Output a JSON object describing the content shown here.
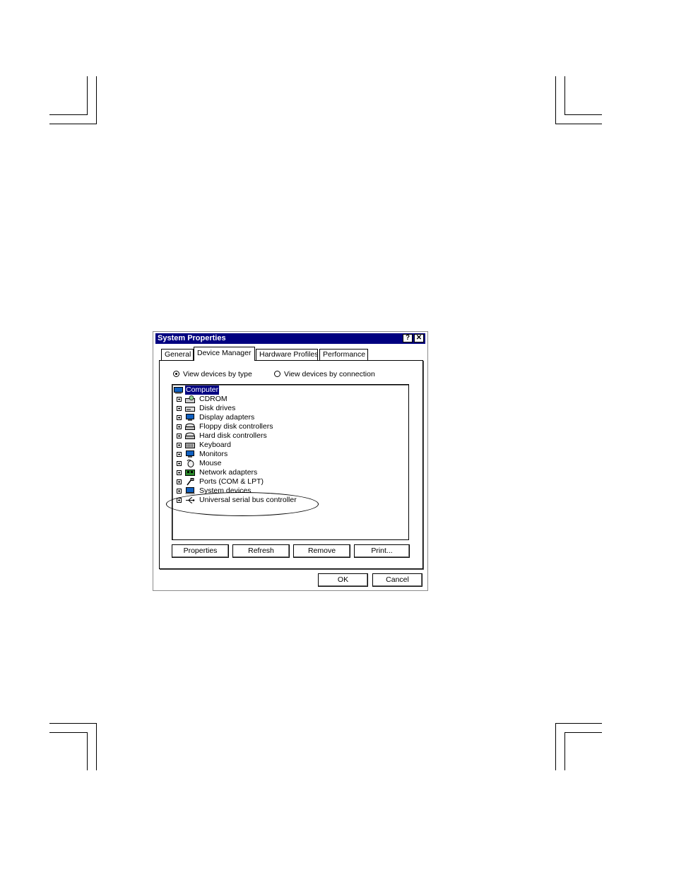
{
  "window": {
    "title": "System Properties",
    "help_button": "?",
    "close_button": "✕"
  },
  "tabs": [
    {
      "label": "General"
    },
    {
      "label": "Device Manager"
    },
    {
      "label": "Hardware Profiles"
    },
    {
      "label": "Performance"
    }
  ],
  "active_tab": "Device Manager",
  "view_options": {
    "by_type": "View devices by type",
    "by_connection": "View devices by connection",
    "selected": "by_type"
  },
  "tree": {
    "root": "Computer",
    "items": [
      {
        "label": "CDROM",
        "icon": "cdrom-icon"
      },
      {
        "label": "Disk drives",
        "icon": "disk-drive-icon"
      },
      {
        "label": "Display adapters",
        "icon": "display-adapter-icon"
      },
      {
        "label": "Floppy disk controllers",
        "icon": "floppy-controller-icon"
      },
      {
        "label": "Hard disk controllers",
        "icon": "hard-disk-controller-icon"
      },
      {
        "label": "Keyboard",
        "icon": "keyboard-icon"
      },
      {
        "label": "Monitors",
        "icon": "monitor-icon"
      },
      {
        "label": "Mouse",
        "icon": "mouse-icon"
      },
      {
        "label": "Network adapters",
        "icon": "network-adapter-icon"
      },
      {
        "label": "Ports (COM & LPT)",
        "icon": "port-icon"
      },
      {
        "label": "System devices",
        "icon": "system-device-icon"
      },
      {
        "label": "Universal serial bus controller",
        "icon": "usb-icon"
      }
    ]
  },
  "buttons": {
    "properties": "Properties",
    "refresh": "Refresh",
    "remove": "Remove",
    "print": "Print...",
    "ok": "OK",
    "cancel": "Cancel"
  },
  "colors": {
    "titlebar": "#000080",
    "selection": "#000080"
  }
}
